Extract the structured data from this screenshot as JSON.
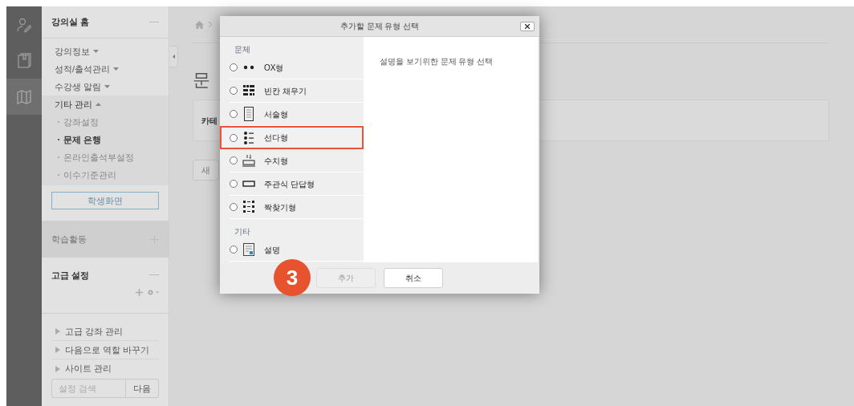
{
  "rail": [
    {
      "selected": false
    },
    {
      "selected": false
    },
    {
      "selected": true
    }
  ],
  "sidebar": {
    "header": "강의실 홈",
    "nav": [
      {
        "label": "강의정보",
        "expanded": false
      },
      {
        "label": "성적/출석관리",
        "expanded": false
      },
      {
        "label": "수강생 알림",
        "expanded": false
      },
      {
        "label": "기타 관리",
        "expanded": true,
        "children": [
          {
            "label": "강좌설정",
            "selected": false
          },
          {
            "label": "문제 은행",
            "selected": true
          },
          {
            "label": "온라인출석부설정",
            "selected": false
          },
          {
            "label": "이수기준관리",
            "selected": false
          }
        ]
      }
    ],
    "student_view_button": "학생화면",
    "blocks": [
      {
        "title": "학습활동",
        "expanded": false
      },
      {
        "title": "고급 설정",
        "expanded": true
      }
    ],
    "admin_tree": [
      {
        "label": "고급 강좌 관리",
        "expanded": false
      },
      {
        "label": "다음으로 역할 바꾸기",
        "expanded": false
      },
      {
        "label": "사이트 관리",
        "expanded": false
      }
    ],
    "search": {
      "placeholder": "설정 검색",
      "button": "다음"
    }
  },
  "main": {
    "title": "문",
    "card_label": "카테",
    "button": "새"
  },
  "dialog": {
    "title": "추가할 문제 유형 선택",
    "sections": [
      {
        "label": "문제",
        "options": [
          {
            "label": "OX형",
            "selected": false,
            "highlighted": false
          },
          {
            "label": "빈칸 채우기",
            "selected": false,
            "highlighted": false
          },
          {
            "label": "서술형",
            "selected": false,
            "highlighted": false
          },
          {
            "label": "선다형",
            "selected": false,
            "highlighted": true
          },
          {
            "label": "수치형",
            "selected": false,
            "highlighted": false
          },
          {
            "label": "주관식 단답형",
            "selected": false,
            "highlighted": false
          },
          {
            "label": "짝찾기형",
            "selected": false,
            "highlighted": false
          }
        ]
      },
      {
        "label": "기타",
        "options": [
          {
            "label": "설명",
            "selected": false,
            "highlighted": false
          }
        ]
      }
    ],
    "description": "설명을 보기위한 문제 유형 선택",
    "buttons": [
      {
        "label": "추가",
        "disabled": true
      },
      {
        "label": "취소",
        "disabled": false
      }
    ],
    "step_badge": "3"
  }
}
